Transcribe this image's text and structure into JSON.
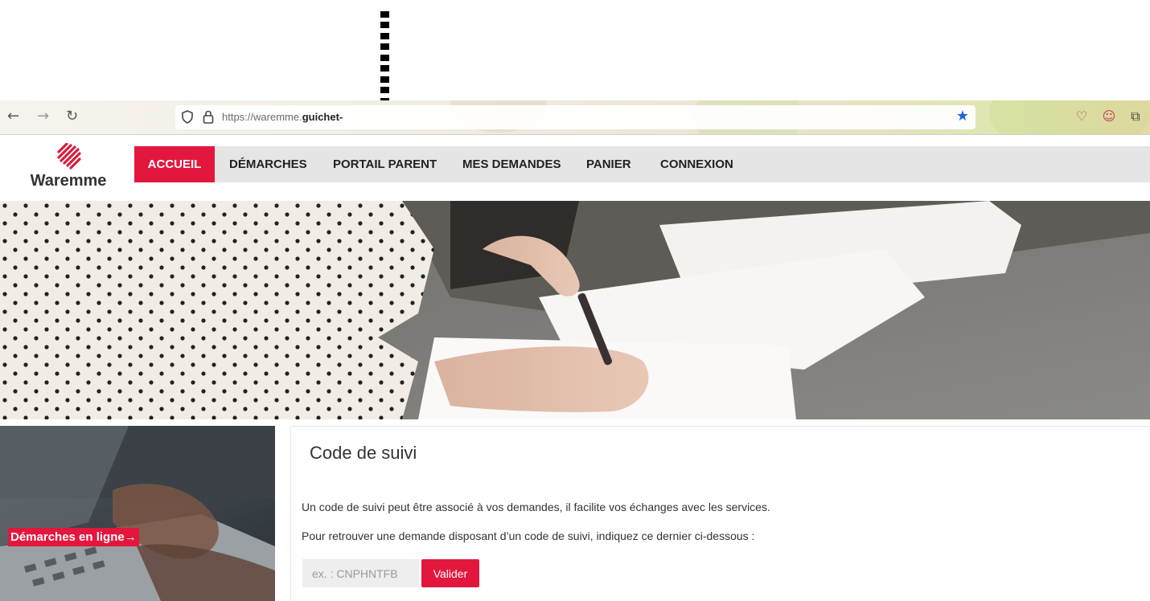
{
  "browser": {
    "url_prefix": "https://waremme.",
    "url_domain": "guichet-",
    "icons": [
      "back-icon",
      "forward-icon",
      "reload-icon",
      "shield-icon",
      "lock-icon",
      "bookmark-star-icon",
      "pocket-icon",
      "account-icon",
      "extensions-icon"
    ]
  },
  "site": {
    "logo_text": "Waremme",
    "nav": [
      {
        "label": "ACCUEIL",
        "active": true
      },
      {
        "label": "DÉMARCHES",
        "active": false
      },
      {
        "label": "PORTAIL PARENT",
        "active": false
      },
      {
        "label": "MES DEMANDES",
        "active": false
      },
      {
        "label": "PANIER",
        "active": false
      },
      {
        "label": "CONNEXION",
        "active": false
      }
    ],
    "accent_color": "#e3173d"
  },
  "promo": {
    "label": "Démarches en ligne→"
  },
  "tracking": {
    "title": "Code de suivi",
    "intro": "Un code de suivi peut être associé à vos demandes, il facilite vos échanges avec les services.",
    "instruction": "Pour retrouver une demande disposant d’un code de suivi, indiquez ce dernier ci-dessous :",
    "input_placeholder": "ex. : CNPHNTFB",
    "input_value": "",
    "submit_label": "Valider"
  }
}
